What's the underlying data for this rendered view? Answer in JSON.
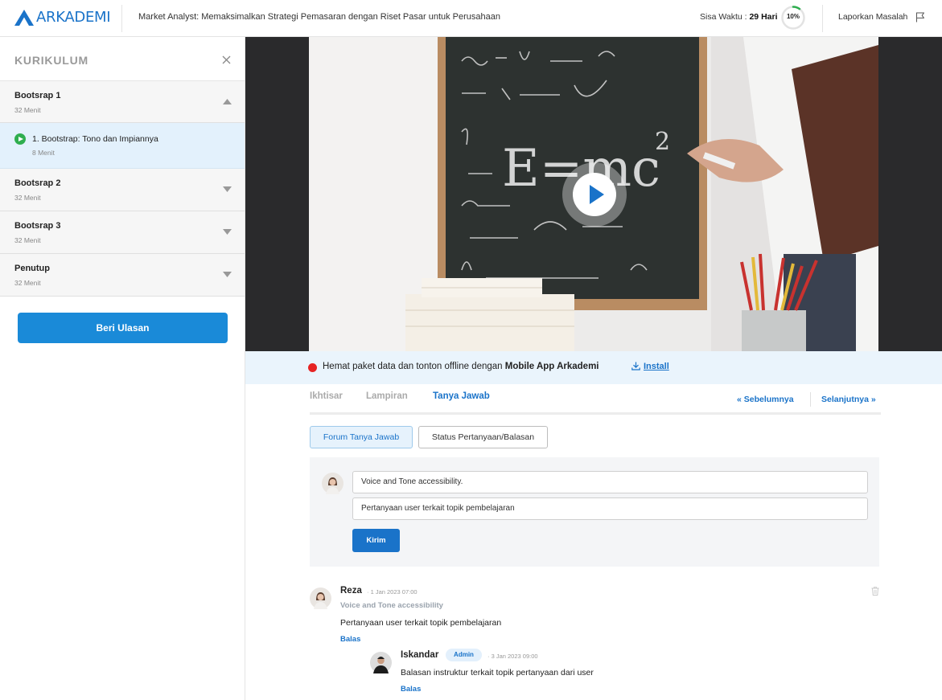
{
  "header": {
    "logo_text": "ARKADEMI",
    "course_title": "Market Analyst: Memaksimalkan Strategi Pemasaran dengan Riset Pasar untuk Perusahaan",
    "time_label": "Sisa Waktu : ",
    "time_value": "29 Hari",
    "progress_text": "10%",
    "progress_fraction": 0.1,
    "report_label": "Laporkan Masalah"
  },
  "sidebar": {
    "title": "KURIKULUM",
    "sections": [
      {
        "title": "Bootsrap 1",
        "duration": "32 Menit"
      },
      {
        "title": "Bootsrap 2",
        "duration": "32 Menit"
      },
      {
        "title": "Bootsrap 3",
        "duration": "32 Menit"
      },
      {
        "title": "Penutup",
        "duration": "32 Menit"
      }
    ],
    "lesson": {
      "title": "1. Bootstrap: Tono dan Impiannya",
      "duration": "8 Menit"
    },
    "review_button": "Beri Ulasan"
  },
  "banner": {
    "text_prefix": "Hemat paket data dan tonton offline dengan ",
    "text_bold": "Mobile App Arkademi",
    "install_label": "Install"
  },
  "tabs": [
    "Ikhtisar",
    "Lampiran",
    "Tanya Jawab"
  ],
  "nav": {
    "prev": "« Sebelumnya",
    "next": "Selanjutnya »"
  },
  "subtabs": {
    "forum": "Forum Tanya Jawab",
    "status": "Status Pertanyaan/Balasan"
  },
  "ask": {
    "title_value": "Voice and Tone accessibility.",
    "question_value": "Pertanyaan user terkait topik pembelajaran",
    "send_label": "Kirim"
  },
  "comments": [
    {
      "name": "Reza",
      "date": "· 1 Jan 2023   07:00",
      "subject": "Voice and Tone accessibility",
      "body": "Pertanyaan user terkait topik pembelajaran",
      "reply_label": "Balas"
    },
    {
      "name": "Iskandar",
      "badge": "Admin",
      "date": "· 3 Jan 2023   09:00",
      "body": "Balasan instruktur terkait topik pertanyaan dari user",
      "reply_label": "Balas"
    }
  ],
  "colors": {
    "brand": "#1a73c9",
    "review_button": "#1a8ad8",
    "play_green": "#2fae4f",
    "alert_red": "#e62323"
  }
}
